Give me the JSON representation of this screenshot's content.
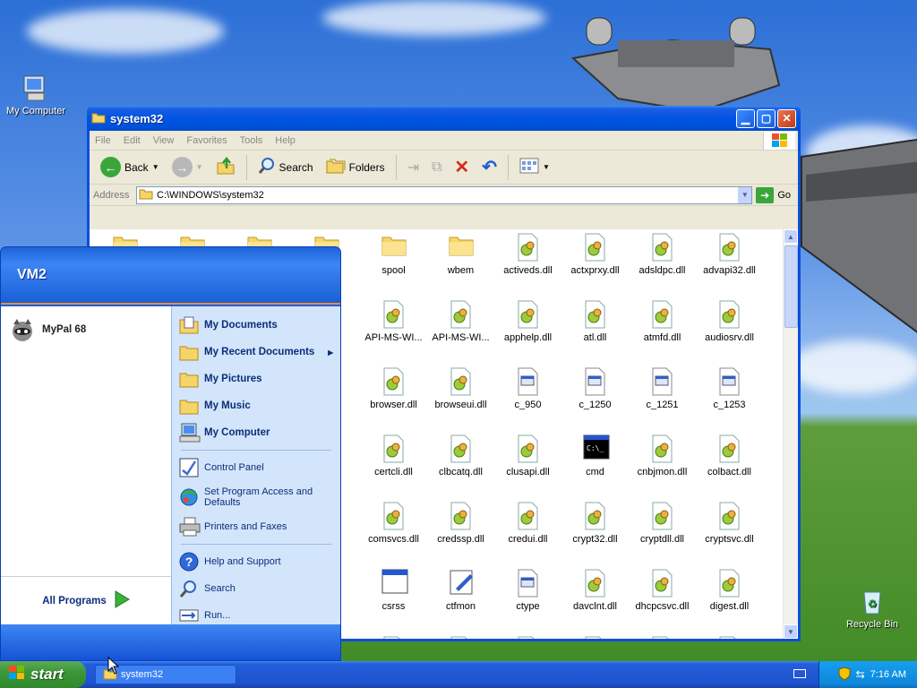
{
  "desktop": {
    "icons": [
      {
        "label": "My Computer"
      },
      {
        "label": "Recycle Bin"
      }
    ]
  },
  "window": {
    "title": "system32",
    "menu": [
      "File",
      "Edit",
      "View",
      "Favorites",
      "Tools",
      "Help"
    ],
    "toolbar": {
      "back": "Back",
      "search": "Search",
      "folders": "Folders"
    },
    "address": {
      "label": "Address",
      "value": "C:\\WINDOWS\\system32",
      "go": "Go"
    },
    "files": [
      {
        "name": "",
        "type": "folder"
      },
      {
        "name": "",
        "type": "folder"
      },
      {
        "name": "",
        "type": "folder"
      },
      {
        "name": "",
        "type": "folder"
      },
      {
        "name": "spool",
        "type": "folder"
      },
      {
        "name": "wbem",
        "type": "folder"
      },
      {
        "name": "activeds.dll",
        "type": "dll"
      },
      {
        "name": "actxprxy.dll",
        "type": "dll"
      },
      {
        "name": "adsldpc.dll",
        "type": "dll"
      },
      {
        "name": "advapi32.dll",
        "type": "dll"
      },
      {
        "name": "",
        "type": "dll"
      },
      {
        "name": "",
        "type": "dll"
      },
      {
        "name": "",
        "type": "dll"
      },
      {
        "name": "",
        "type": "dll"
      },
      {
        "name": "API-MS-WI...",
        "type": "dll"
      },
      {
        "name": "API-MS-WI...",
        "type": "dll"
      },
      {
        "name": "apphelp.dll",
        "type": "dll"
      },
      {
        "name": "atl.dll",
        "type": "dll"
      },
      {
        "name": "atmfd.dll",
        "type": "dll"
      },
      {
        "name": "audiosrv.dll",
        "type": "dll"
      },
      {
        "name": "",
        "type": "dll"
      },
      {
        "name": "",
        "type": "dll"
      },
      {
        "name": "",
        "type": "dll"
      },
      {
        "name": "",
        "type": "dll"
      },
      {
        "name": "browser.dll",
        "type": "dll"
      },
      {
        "name": "browseui.dll",
        "type": "dll"
      },
      {
        "name": "c_950",
        "type": "nls"
      },
      {
        "name": "c_1250",
        "type": "nls"
      },
      {
        "name": "c_1251",
        "type": "nls"
      },
      {
        "name": "c_1253",
        "type": "nls"
      },
      {
        "name": "",
        "type": "dll"
      },
      {
        "name": "",
        "type": "dll"
      },
      {
        "name": "",
        "type": "dll"
      },
      {
        "name": "",
        "type": "dll"
      },
      {
        "name": "certcli.dll",
        "type": "dll"
      },
      {
        "name": "clbcatq.dll",
        "type": "dll"
      },
      {
        "name": "clusapi.dll",
        "type": "dll"
      },
      {
        "name": "cmd",
        "type": "cmd"
      },
      {
        "name": "cnbjmon.dll",
        "type": "dll"
      },
      {
        "name": "colbact.dll",
        "type": "dll"
      },
      {
        "name": "",
        "type": "dll"
      },
      {
        "name": "",
        "type": "dll"
      },
      {
        "name": "",
        "type": "dll"
      },
      {
        "name": "",
        "type": "dll"
      },
      {
        "name": "comsvcs.dll",
        "type": "dll"
      },
      {
        "name": "credssp.dll",
        "type": "dll"
      },
      {
        "name": "credui.dll",
        "type": "dll"
      },
      {
        "name": "crypt32.dll",
        "type": "dll"
      },
      {
        "name": "cryptdll.dll",
        "type": "dll"
      },
      {
        "name": "cryptsvc.dll",
        "type": "dll"
      },
      {
        "name": "",
        "type": "dll"
      },
      {
        "name": "",
        "type": "dll"
      },
      {
        "name": "",
        "type": "dll"
      },
      {
        "name": "",
        "type": "dll"
      },
      {
        "name": "csrss",
        "type": "exe"
      },
      {
        "name": "ctfmon",
        "type": "ctf"
      },
      {
        "name": "ctype",
        "type": "nls"
      },
      {
        "name": "davclnt.dll",
        "type": "dll"
      },
      {
        "name": "dhcpcsvc.dll",
        "type": "dll"
      },
      {
        "name": "digest.dll",
        "type": "dll"
      },
      {
        "name": "",
        "type": "dll"
      },
      {
        "name": "",
        "type": "dll"
      },
      {
        "name": "",
        "type": "dll"
      },
      {
        "name": "",
        "type": "dll"
      },
      {
        "name": "",
        "type": "dll"
      },
      {
        "name": "",
        "type": "dll"
      },
      {
        "name": "",
        "type": "dll"
      },
      {
        "name": "",
        "type": "dll"
      },
      {
        "name": "",
        "type": "dll"
      },
      {
        "name": "",
        "type": "dll"
      }
    ]
  },
  "startmenu": {
    "user": "VM2",
    "pinned": [
      {
        "label": "MyPal 68"
      }
    ],
    "all_programs": "All Programs",
    "right": [
      {
        "label": "My Documents",
        "bold": true,
        "icon": "folder-docs-icon"
      },
      {
        "label": "My Recent Documents",
        "bold": true,
        "icon": "folder-recent-icon",
        "arrow": true
      },
      {
        "label": "My Pictures",
        "bold": true,
        "icon": "folder-pictures-icon"
      },
      {
        "label": "My Music",
        "bold": true,
        "icon": "folder-music-icon"
      },
      {
        "label": "My Computer",
        "bold": true,
        "icon": "computer-icon"
      },
      {
        "label": "Control Panel",
        "bold": false,
        "icon": "control-panel-icon"
      },
      {
        "label": "Set Program Access and Defaults",
        "bold": false,
        "icon": "program-defaults-icon"
      },
      {
        "label": "Printers and Faxes",
        "bold": false,
        "icon": "printer-icon"
      },
      {
        "label": "Help and Support",
        "bold": false,
        "icon": "help-icon"
      },
      {
        "label": "Search",
        "bold": false,
        "icon": "search-icon"
      },
      {
        "label": "Run...",
        "bold": false,
        "icon": "run-icon"
      }
    ]
  },
  "taskbar": {
    "start": "start",
    "tasks": [
      {
        "label": "system32"
      }
    ],
    "clock": "7:16 AM"
  }
}
